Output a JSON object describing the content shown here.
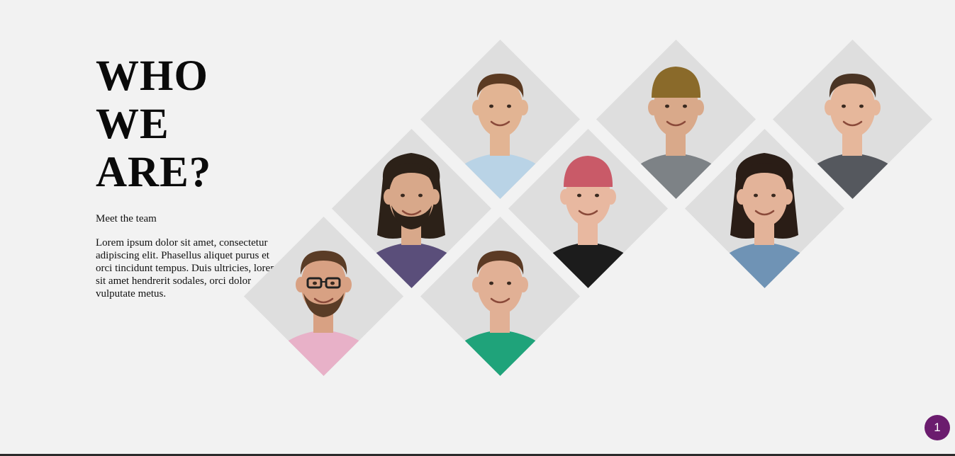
{
  "intro": {
    "title": "WHO WE ARE?",
    "subtitle": "Meet the team",
    "body": "Lorem ipsum dolor sit amet, consectetur adipiscing elit. Phasellus aliquet purus et orci tincidunt tempus. Duis ultricies, lorem sit amet hendrerit sodales, orci dolor vulputate metus."
  },
  "team": [
    {
      "name": "team-member-1",
      "hair": "#5b3a22",
      "skin": "#e2b493",
      "shirt": "#b9d3e6",
      "hat": "",
      "beard": false,
      "glasses": false,
      "long_hair": false
    },
    {
      "name": "team-member-2",
      "hair": "#3a2a1c",
      "skin": "#d9a98a",
      "shirt": "#7d8286",
      "hat": "#8a6a2a",
      "beard": false,
      "glasses": false,
      "long_hair": false
    },
    {
      "name": "team-member-3",
      "hair": "#4a3424",
      "skin": "#e6b79b",
      "shirt": "#55585e",
      "hat": "",
      "beard": false,
      "glasses": false,
      "long_hair": false
    },
    {
      "name": "team-member-4",
      "hair": "#2c2118",
      "skin": "#d8a88a",
      "shirt": "#5a4e7a",
      "hat": "",
      "beard": true,
      "glasses": false,
      "long_hair": true
    },
    {
      "name": "team-member-5",
      "hair": "#c7c0b8",
      "skin": "#e8b8a0",
      "shirt": "#1c1c1c",
      "hat": "#c95a68",
      "beard": false,
      "glasses": false,
      "long_hair": false
    },
    {
      "name": "team-member-6",
      "hair": "#2a1d16",
      "skin": "#e3b399",
      "shirt": "#6f93b5",
      "hat": "",
      "beard": false,
      "glasses": false,
      "long_hair": true
    },
    {
      "name": "team-member-7",
      "hair": "#5a3c26",
      "skin": "#d8a183",
      "shirt": "#e8b1c8",
      "hat": "",
      "beard": true,
      "glasses": true,
      "long_hair": false
    },
    {
      "name": "team-member-8",
      "hair": "#5b3a24",
      "skin": "#e1b095",
      "shirt": "#1fa37a",
      "hat": "",
      "beard": false,
      "glasses": false,
      "long_hair": false
    }
  ],
  "fab": {
    "label": "1",
    "color": "#6b1c6e"
  }
}
